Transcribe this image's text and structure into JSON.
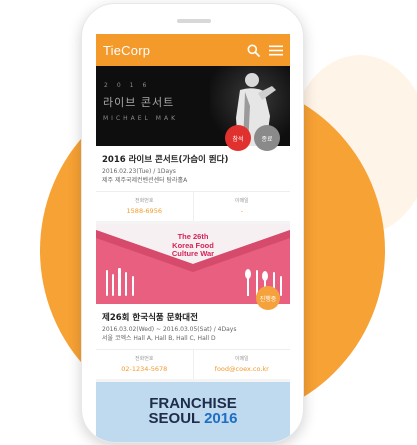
{
  "app": {
    "logo": "TieCorp",
    "icons": {
      "search": "search-icon",
      "menu": "hamburger-menu-icon"
    }
  },
  "events": [
    {
      "banner": {
        "year": "2016",
        "title": "라이브 콘서트",
        "artist": "MICHAEL MAK"
      },
      "badges": [
        "참석",
        "종료"
      ],
      "title": "2016 라이브 콘서트(가슴이 뛴다)",
      "date": "2016.02.23(Tue) / 1Days",
      "place": "제주 제주국제컨벤션센터 탐라홀A",
      "contact": {
        "phone_label": "전화번호",
        "phone": "1588-6956",
        "email_label": "이메일",
        "email": "-"
      }
    },
    {
      "banner": {
        "line1": "The 26th",
        "line2": "Korea Food",
        "line3": "Culture War"
      },
      "badges": [
        "진행중"
      ],
      "title": "제26회 한국식품 문화대전",
      "date": "2016.03.02(Wed) ~ 2016.03.05(Sat) / 4Days",
      "place": "서울 코엑스 Hall A, Hall B, Hall C, Hall D",
      "contact": {
        "phone_label": "전화번호",
        "phone": "02-1234-5678",
        "email_label": "이메일",
        "email": "food@coex.co.kr"
      }
    },
    {
      "banner": {
        "line1": "FRANCHISE",
        "line2": "SEOUL",
        "year": "2016"
      }
    }
  ],
  "colors": {
    "accent": "#f39a2b",
    "red_badge": "#e0312e",
    "gray_badge": "#8a8a8a",
    "food_bg": "#e95f7f"
  }
}
